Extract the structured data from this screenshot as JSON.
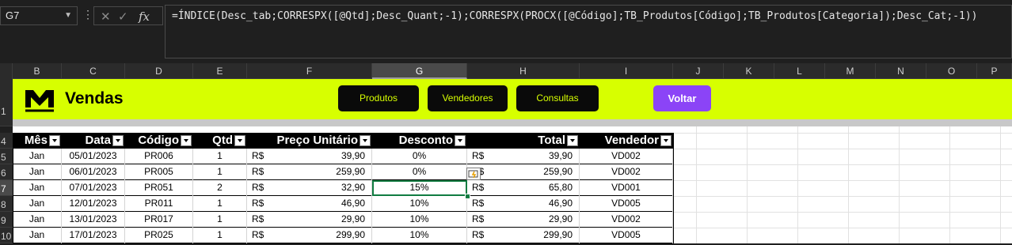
{
  "formula_bar": {
    "name_box": "G7",
    "formula": "=ÍNDICE(Desc_tab;CORRESPX([@Qtd];Desc_Quant;-1);CORRESPX(PROCX([@Código];TB_Produtos[Código];TB_Produtos[Categoria]);Desc_Cat;-1))",
    "icons": [
      "cancel-icon",
      "enter-icon",
      "insert-function-icon"
    ]
  },
  "columns": [
    "B",
    "C",
    "D",
    "E",
    "F",
    "G",
    "H",
    "I",
    "J",
    "K",
    "L",
    "M",
    "N",
    "O",
    "P"
  ],
  "selected_column": "G",
  "rows": [
    "1",
    "4",
    "5",
    "6",
    "7",
    "8",
    "9",
    "10"
  ],
  "selected_row": "7",
  "banner": {
    "title": "Vendas",
    "nav": [
      "Produtos",
      "Vendedores",
      "Consultas"
    ],
    "back": "Voltar",
    "accent": "#d7ff00",
    "back_color": "#8b44f7"
  },
  "table": {
    "headers": [
      "Mês",
      "Data",
      "Código",
      "Qtd",
      "Preço Unitário",
      "Desconto",
      "Total",
      "Vendedor"
    ],
    "currency": "R$",
    "rows": [
      {
        "mes": "Jan",
        "data": "05/01/2023",
        "codigo": "PR006",
        "qtd": "1",
        "preco": "39,90",
        "desconto": "0%",
        "total": "39,90",
        "vendedor": "VD002"
      },
      {
        "mes": "Jan",
        "data": "06/01/2023",
        "codigo": "PR005",
        "qtd": "1",
        "preco": "259,90",
        "desconto": "0%",
        "total": "259,90",
        "vendedor": "VD002"
      },
      {
        "mes": "Jan",
        "data": "07/01/2023",
        "codigo": "PR051",
        "qtd": "2",
        "preco": "32,90",
        "desconto": "15%",
        "total": "65,80",
        "vendedor": "VD001"
      },
      {
        "mes": "Jan",
        "data": "12/01/2023",
        "codigo": "PR011",
        "qtd": "1",
        "preco": "46,90",
        "desconto": "10%",
        "total": "46,90",
        "vendedor": "VD005"
      },
      {
        "mes": "Jan",
        "data": "13/01/2023",
        "codigo": "PR017",
        "qtd": "1",
        "preco": "29,90",
        "desconto": "10%",
        "total": "29,90",
        "vendedor": "VD002"
      },
      {
        "mes": "Jan",
        "data": "17/01/2023",
        "codigo": "PR025",
        "qtd": "1",
        "preco": "299,90",
        "desconto": "10%",
        "total": "299,90",
        "vendedor": "VD005"
      }
    ]
  }
}
